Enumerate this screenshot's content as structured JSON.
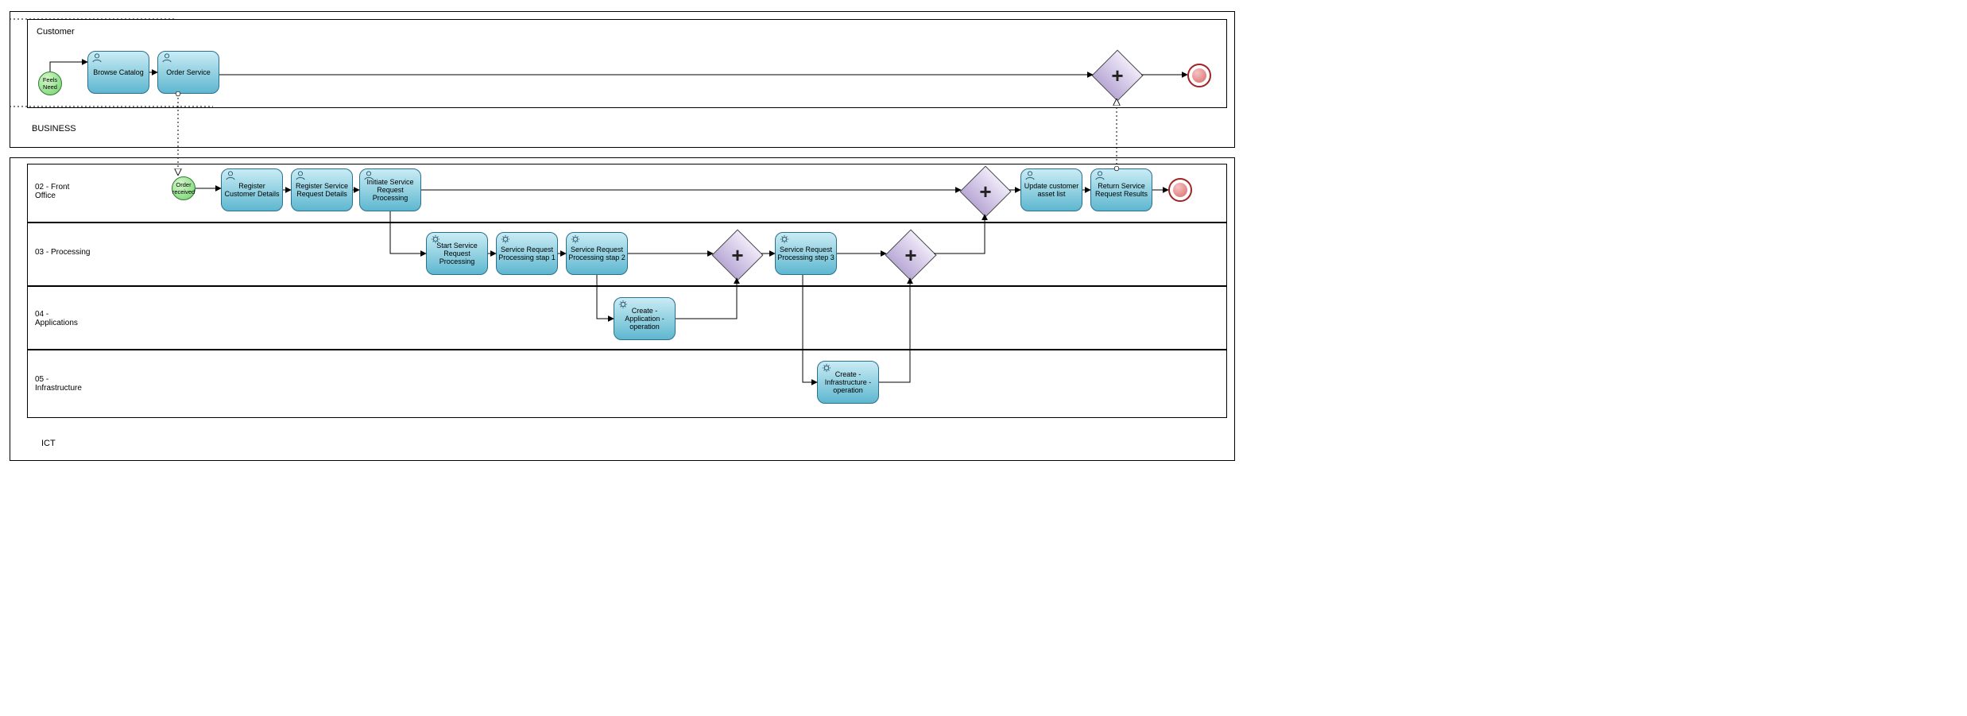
{
  "diagram_type": "BPMN Process Diagram",
  "pools": {
    "business": {
      "label": "BUSINESS"
    },
    "ict": {
      "label": "ICT"
    }
  },
  "lanes": {
    "customer": {
      "label": "Customer"
    },
    "front_office": {
      "label": "02 - Front Office"
    },
    "processing": {
      "label": "03 - Processing"
    },
    "applications": {
      "label": "04 - Applications"
    },
    "infrastructure": {
      "label": "05 - Infrastructure"
    }
  },
  "events": {
    "feels_need": {
      "label": "Feels Need"
    },
    "order_received": {
      "label": "Order received"
    }
  },
  "tasks": {
    "browse_catalog": {
      "label": "Browse Catalog",
      "marker": "user"
    },
    "order_service": {
      "label": "Order Service",
      "marker": "user"
    },
    "register_customer": {
      "label": "Register Customer Details",
      "marker": "user"
    },
    "register_srv_request": {
      "label": "Register Service Request Details",
      "marker": "user"
    },
    "initiate_srp": {
      "label": "Initiate Service Request Processing",
      "marker": "user"
    },
    "start_srp": {
      "label": "Start Service Request Processing",
      "marker": "gear"
    },
    "srp_step1": {
      "label": "Service Request Processing stap 1",
      "marker": "gear"
    },
    "srp_step2": {
      "label": "Service Request Processing stap 2",
      "marker": "gear"
    },
    "srp_step3": {
      "label": "Service Request Processing step 3",
      "marker": "gear"
    },
    "create_app_op": {
      "label": "Create -Application -operation",
      "marker": "gear"
    },
    "create_infra_op": {
      "label": "Create -Infrastructure -operation",
      "marker": "gear"
    },
    "update_assets": {
      "label": "Update customer asset list",
      "marker": "user"
    },
    "return_results": {
      "label": "Return Service Request Results",
      "marker": "user"
    }
  },
  "gateways": {
    "g_cust": {
      "type": "parallel"
    },
    "g_proc_a": {
      "type": "parallel"
    },
    "g_proc_b": {
      "type": "parallel"
    },
    "g_front": {
      "type": "parallel"
    }
  },
  "flows": [
    [
      "feels_need",
      "browse_catalog",
      "sequence"
    ],
    [
      "browse_catalog",
      "order_service",
      "sequence"
    ],
    [
      "order_service",
      "g_cust",
      "sequence"
    ],
    [
      "g_cust",
      "end_customer",
      "sequence"
    ],
    [
      "order_service",
      "order_received",
      "message"
    ],
    [
      "order_received",
      "register_customer",
      "sequence"
    ],
    [
      "register_customer",
      "register_srv_request",
      "sequence"
    ],
    [
      "register_srv_request",
      "initiate_srp",
      "sequence"
    ],
    [
      "initiate_srp",
      "update_assets",
      "sequence"
    ],
    [
      "initiate_srp",
      "start_srp",
      "sequence"
    ],
    [
      "start_srp",
      "srp_step1",
      "sequence"
    ],
    [
      "srp_step1",
      "srp_step2",
      "sequence"
    ],
    [
      "srp_step2",
      "g_proc_a",
      "sequence"
    ],
    [
      "srp_step2",
      "create_app_op",
      "sequence"
    ],
    [
      "create_app_op",
      "g_proc_a",
      "sequence"
    ],
    [
      "g_proc_a",
      "srp_step3",
      "sequence"
    ],
    [
      "g_proc_a",
      "create_infra_op",
      "sequence"
    ],
    [
      "srp_step3",
      "g_proc_b",
      "sequence"
    ],
    [
      "create_infra_op",
      "g_proc_b",
      "sequence"
    ],
    [
      "g_proc_b",
      "g_front",
      "sequence"
    ],
    [
      "g_front",
      "update_assets",
      "sequence"
    ],
    [
      "update_assets",
      "return_results",
      "sequence"
    ],
    [
      "return_results",
      "end_front",
      "sequence"
    ],
    [
      "return_results",
      "g_cust",
      "message"
    ]
  ]
}
